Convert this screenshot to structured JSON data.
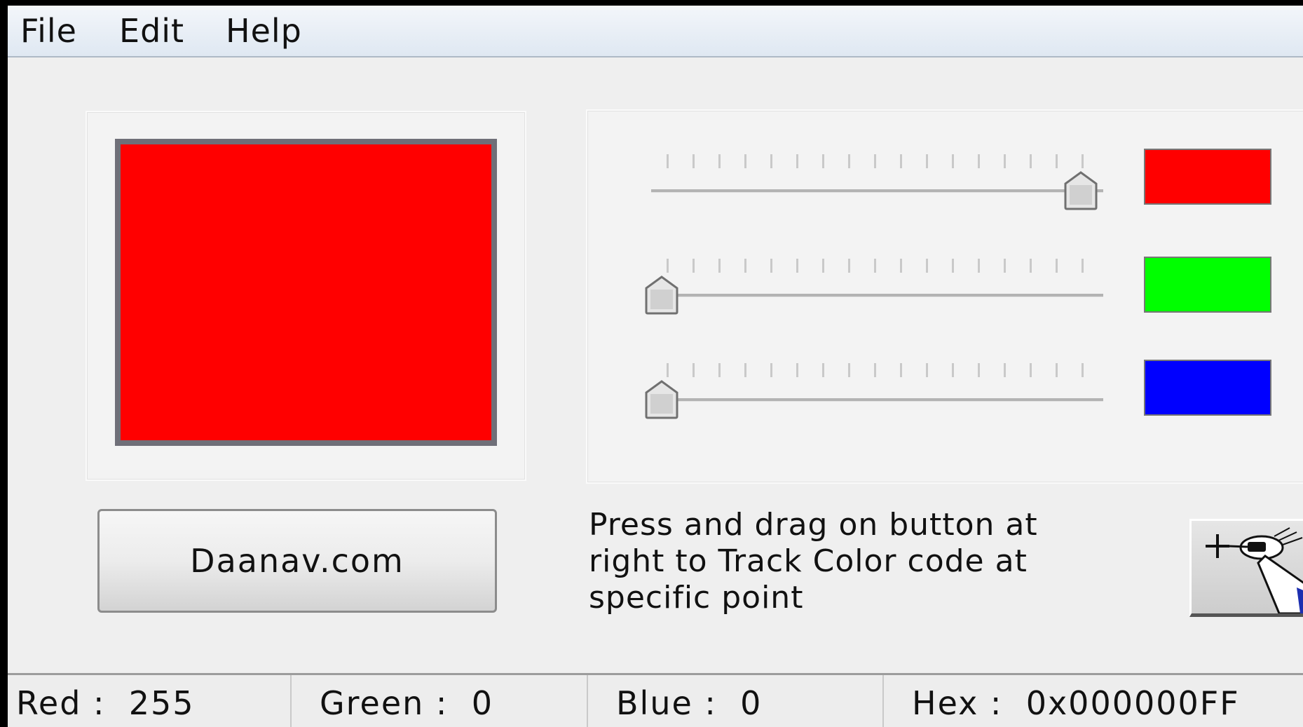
{
  "menu": {
    "file": "File",
    "edit": "Edit",
    "help": "Help"
  },
  "preview": {
    "color": "#ff0000"
  },
  "sliders": [
    {
      "channel": "red",
      "value": 255,
      "max": 255,
      "swatch_color": "#ff0000"
    },
    {
      "channel": "green",
      "value": 0,
      "max": 255,
      "swatch_color": "#00ff00"
    },
    {
      "channel": "blue",
      "value": 0,
      "max": 255,
      "swatch_color": "#0000ff"
    }
  ],
  "action_button": {
    "label": "Daanav.com"
  },
  "hint": {
    "text": "Press and drag on button at right to Track Color code at specific point"
  },
  "picker_button": {
    "icon": "eyedropper-crosshair-icon"
  },
  "status": {
    "red_label": "Red :",
    "red_value": "255",
    "green_label": "Green :",
    "green_value": "0",
    "blue_label": "Blue :",
    "blue_value": "0",
    "hex_label": "Hex :",
    "hex_value": "0x000000FF"
  }
}
